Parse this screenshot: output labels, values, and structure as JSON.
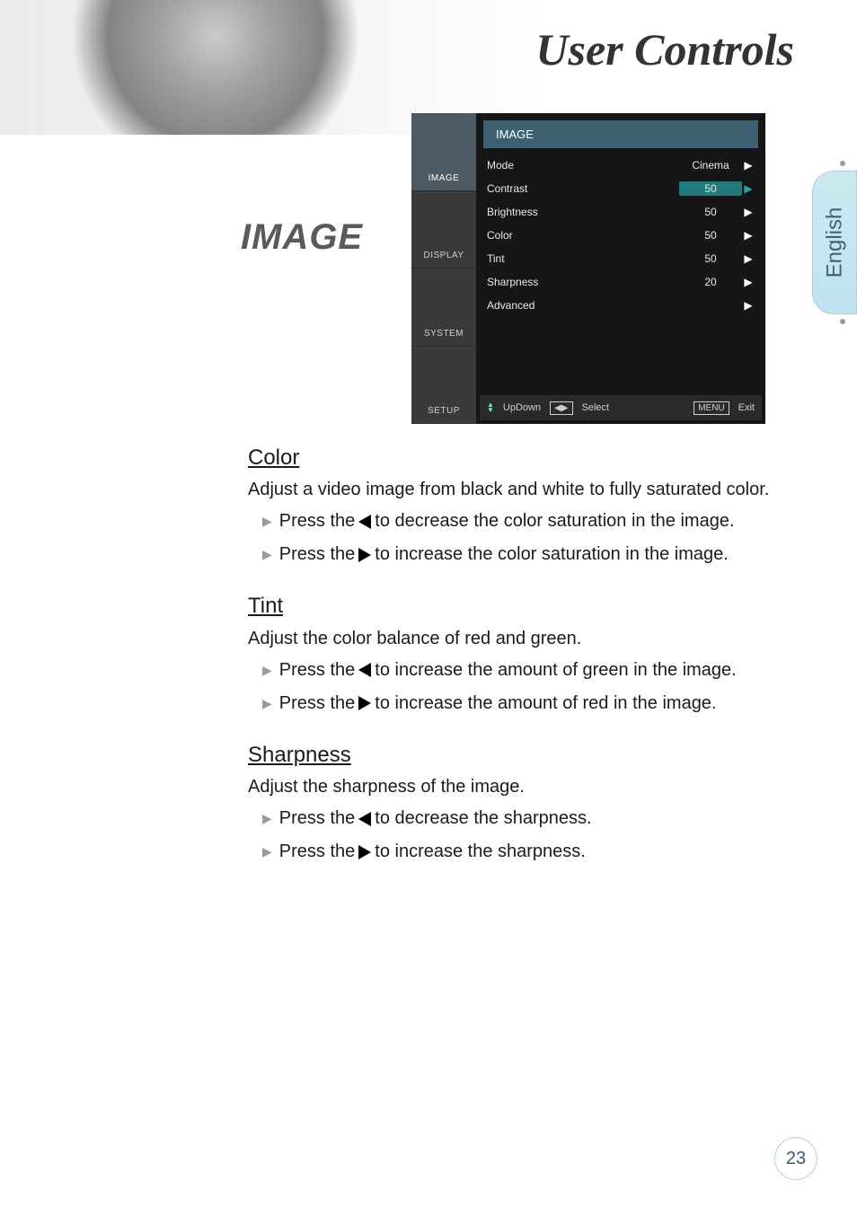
{
  "header": {
    "title": "User Controls"
  },
  "language_tab": "English",
  "section_title": "IMAGE",
  "osd": {
    "title": "IMAGE",
    "tabs": [
      "IMAGE",
      "DISPLAY",
      "SYSTEM",
      "SETUP"
    ],
    "active_tab_index": 0,
    "rows": [
      {
        "label": "Mode",
        "value": "Cinema",
        "highlighted": false
      },
      {
        "label": "Contrast",
        "value": "50",
        "highlighted": true
      },
      {
        "label": "Brightness",
        "value": "50",
        "highlighted": false
      },
      {
        "label": "Color",
        "value": "50",
        "highlighted": false
      },
      {
        "label": "Tint",
        "value": "50",
        "highlighted": false
      },
      {
        "label": "Sharpness",
        "value": "20",
        "highlighted": false
      },
      {
        "label": "Advanced",
        "value": "",
        "highlighted": false
      }
    ],
    "footer": {
      "updown": "UpDown",
      "select": "Select",
      "menu_key": "MENU",
      "exit": "Exit"
    }
  },
  "sections": [
    {
      "title": "Color",
      "desc": "Adjust a video image from black and white to fully saturated color.",
      "bullets": [
        {
          "pre": "Press the ",
          "dir": "left",
          "post": " to decrease the color saturation in the image."
        },
        {
          "pre": "Press the ",
          "dir": "right",
          "post": " to increase the color saturation in the image."
        }
      ]
    },
    {
      "title": "Tint",
      "desc": "Adjust the color balance of red and green.",
      "bullets": [
        {
          "pre": "Press the ",
          "dir": "left",
          "post": " to increase the amount of green in the image."
        },
        {
          "pre": "Press the ",
          "dir": "right",
          "post": " to increase the amount of red in the image."
        }
      ]
    },
    {
      "title": "Sharpness",
      "desc": "Adjust the sharpness of the image.",
      "bullets": [
        {
          "pre": "Press the ",
          "dir": "left",
          "post": " to decrease the sharpness."
        },
        {
          "pre": "Press the ",
          "dir": "right",
          "post": " to increase the sharpness."
        }
      ]
    }
  ],
  "page_number": "23"
}
